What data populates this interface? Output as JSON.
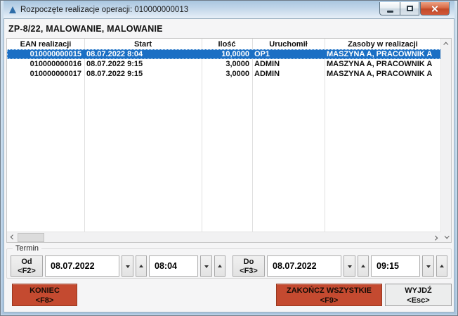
{
  "window": {
    "title": "Rozpoczęte realizacje operacji: 010000000013"
  },
  "header": {
    "title": "ZP-8/22, MALOWANIE, MALOWANIE"
  },
  "table": {
    "columns": {
      "ean": "EAN realizacji",
      "start": "Start",
      "ilosc": "Ilość",
      "uruchomil": "Uruchomił",
      "zasoby": "Zasoby w realizacji"
    },
    "rows": [
      {
        "ean": "010000000015",
        "start": "08.07.2022 8:04",
        "ilosc": "10,0000",
        "uruchomil": "OP1",
        "zasoby": "MASZYNA A, PRACOWNIK A",
        "selected": true
      },
      {
        "ean": "010000000016",
        "start": "08.07.2022 9:15",
        "ilosc": "3,0000",
        "uruchomil": "ADMIN",
        "zasoby": "MASZYNA A, PRACOWNIK A",
        "selected": false
      },
      {
        "ean": "010000000017",
        "start": "08.07.2022 9:15",
        "ilosc": "3,0000",
        "uruchomil": "ADMIN",
        "zasoby": "MASZYNA A, PRACOWNIK A",
        "selected": false
      }
    ]
  },
  "termin": {
    "label": "Termin",
    "od": {
      "label": "Od",
      "key": "<F2>",
      "date": "08.07.2022",
      "time": "08:04"
    },
    "do": {
      "label": "Do",
      "key": "<F3>",
      "date": "08.07.2022",
      "time": "09:15"
    }
  },
  "actions": {
    "koniec": {
      "label": "KONIEC",
      "key": "<F8>"
    },
    "zakoncz": {
      "label": "ZAKOŃCZ WSZYSTKIE",
      "key": "<F9>"
    },
    "wyjdz": {
      "label": "WYJDŹ",
      "key": "<Esc>"
    }
  },
  "colors": {
    "action_red": "#c44a30",
    "selection_blue": "#1b6fc4",
    "frame_blue": "#b9d2e8"
  },
  "icons": {
    "app": "blue-triangle-icon",
    "window": [
      "minimize-icon",
      "maximize-icon",
      "close-icon"
    ],
    "scroll": [
      "chevron-up-icon",
      "chevron-down-icon",
      "chevron-left-icon",
      "chevron-right-icon"
    ],
    "spinner": [
      "triangle-down-icon",
      "triangle-up-icon"
    ]
  }
}
